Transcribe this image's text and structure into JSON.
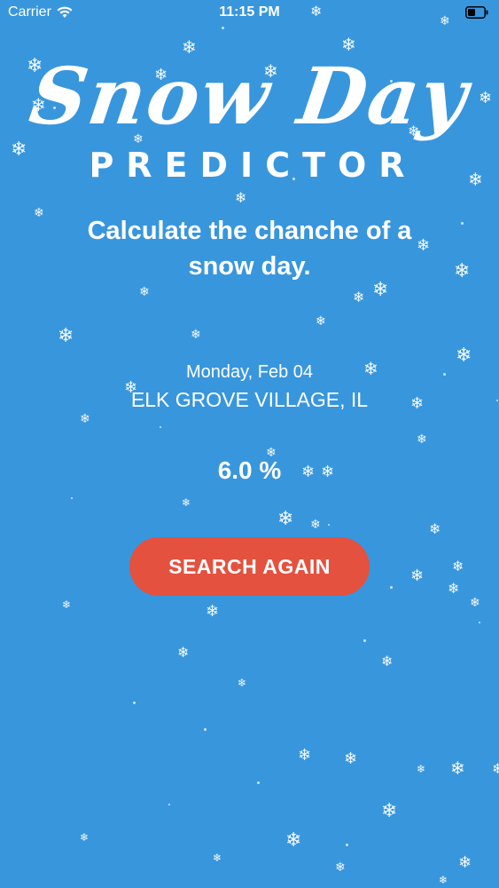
{
  "status_bar": {
    "carrier": "Carrier",
    "time": "11:15 PM",
    "icons": [
      "wifi-icon",
      "battery-icon"
    ]
  },
  "title": {
    "script": "Snow Day",
    "sub": "PREDICTOR"
  },
  "tagline": "Calculate the chanche of a snow day.",
  "forecast": {
    "date": "Monday, Feb 04",
    "location": "ELK GROVE VILLAGE, IL",
    "percent": "6.0 %"
  },
  "actions": {
    "search_again": "SEARCH AGAIN"
  },
  "colors": {
    "background": "#3896DD",
    "button": "#E4513F",
    "text": "#FFFFFF"
  },
  "decoration": {
    "snowflake_icon": "❄"
  }
}
